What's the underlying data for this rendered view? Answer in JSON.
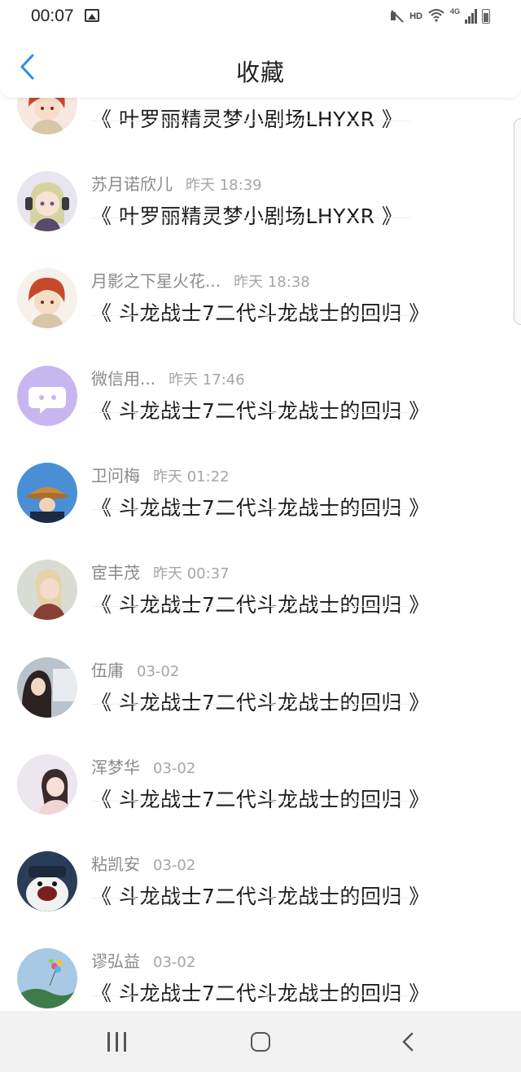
{
  "status_bar": {
    "time": "00:07",
    "network": "4G",
    "hd": "HD"
  },
  "header": {
    "title": "收藏"
  },
  "list": [
    {
      "author": "",
      "time": "",
      "title": "《 叶罗丽精灵梦小剧场LHYXR 》",
      "avatar": "red-hair-character-icon",
      "colors": [
        "#f5e9e2",
        "#c64a2a"
      ]
    },
    {
      "author": "苏月诺欣儿",
      "time": "昨天 18:39",
      "title": "《 叶罗丽精灵梦小剧场LHYXR 》",
      "avatar": "blonde-headphones-character-icon",
      "colors": [
        "#e8e4f0",
        "#d6d3a0"
      ]
    },
    {
      "author": "月影之下星火花...",
      "time": "昨天 18:38",
      "title": "《 斗龙战士7二代斗龙战士的回归 》",
      "avatar": "red-hair-character-icon",
      "colors": [
        "#f7f1ec",
        "#c64a2a"
      ]
    },
    {
      "author": "微信用...",
      "time": "昨天 17:46",
      "title": "《 斗龙战士7二代斗龙战士的回归 》",
      "avatar": "chat-bubble-icon",
      "colors": [
        "#c7b6ef",
        "#ffffff"
      ]
    },
    {
      "author": "卫问梅",
      "time": "昨天 01:22",
      "title": "《 斗龙战士7二代斗龙战士的回归 》",
      "avatar": "bucket-hat-photo-icon",
      "colors": [
        "#4a8fd6",
        "#c98a3c"
      ]
    },
    {
      "author": "宦丰茂",
      "time": "昨天 00:37",
      "title": "《 斗龙战士7二代斗龙战士的回归 》",
      "avatar": "girl-illustration-icon",
      "colors": [
        "#d9dcd2",
        "#8a3f34"
      ]
    },
    {
      "author": "伍庸",
      "time": "03-02",
      "title": "《 斗龙战士7二代斗龙战士的回归 》",
      "avatar": "girl-photo-icon",
      "colors": [
        "#b9c3cc",
        "#2b2222"
      ]
    },
    {
      "author": "浑梦华",
      "time": "03-02",
      "title": "《 斗龙战士7二代斗龙战士的回归 》",
      "avatar": "pink-girl-photo-icon",
      "colors": [
        "#ece6ee",
        "#f0d5d5"
      ]
    },
    {
      "author": "粘凯安",
      "time": "03-02",
      "title": "《 斗龙战士7二代斗龙战士的回归 》",
      "avatar": "bear-cartoon-icon",
      "colors": [
        "#2a3d58",
        "#f2f2f2"
      ]
    },
    {
      "author": "谬弘益",
      "time": "03-02",
      "title": "《 斗龙战士7二代斗龙战士的回归 》",
      "avatar": "balloon-landscape-icon",
      "colors": [
        "#a7c9e3",
        "#3f7a4a"
      ]
    }
  ],
  "nav": {
    "recents": "recents-icon",
    "home": "home-icon",
    "back": "back-icon"
  },
  "colors": {
    "accent": "#2f8ee0",
    "author": "#8a8a8a",
    "time": "#a6a6a6",
    "title": "#1c1c1c"
  }
}
